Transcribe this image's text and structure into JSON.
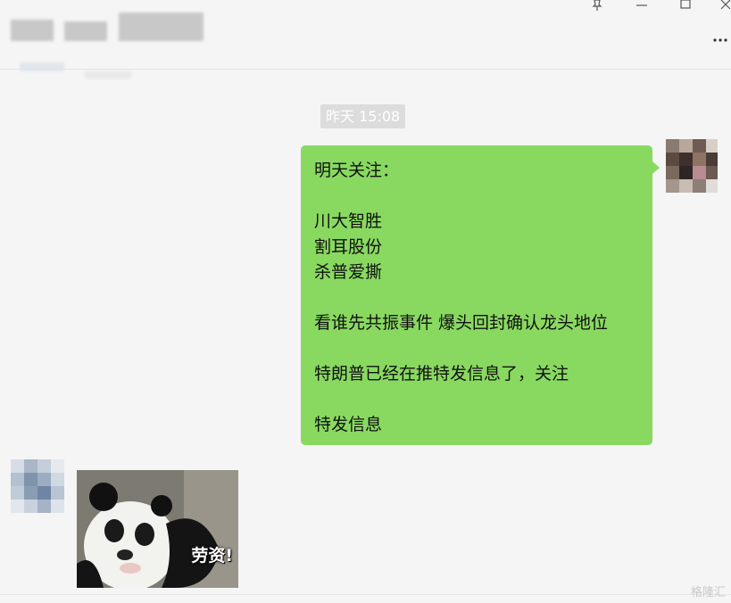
{
  "window": {
    "pin_icon": "pin-icon",
    "minimize_icon": "minimize-icon",
    "maximize_icon": "maximize-icon",
    "close_icon": "close-icon",
    "more_icon": "more-icon"
  },
  "chat": {
    "timestamp": "昨天 15:08",
    "my_message": {
      "lines": [
        "明天关注：",
        "",
        "川大智胜",
        "割耳股份",
        "杀普爱撕",
        "",
        "看谁先共振事件 爆头回封确认龙头地位",
        "",
        "特朗普已经在推特发信息了，关注",
        "",
        "特发信息"
      ]
    },
    "sticker": {
      "caption": "劳资!"
    }
  },
  "watermark": "格隆汇",
  "colors": {
    "background": "#f5f5f5",
    "bubble": "#89d961",
    "timestamp_bg": "#dcdcdc"
  }
}
